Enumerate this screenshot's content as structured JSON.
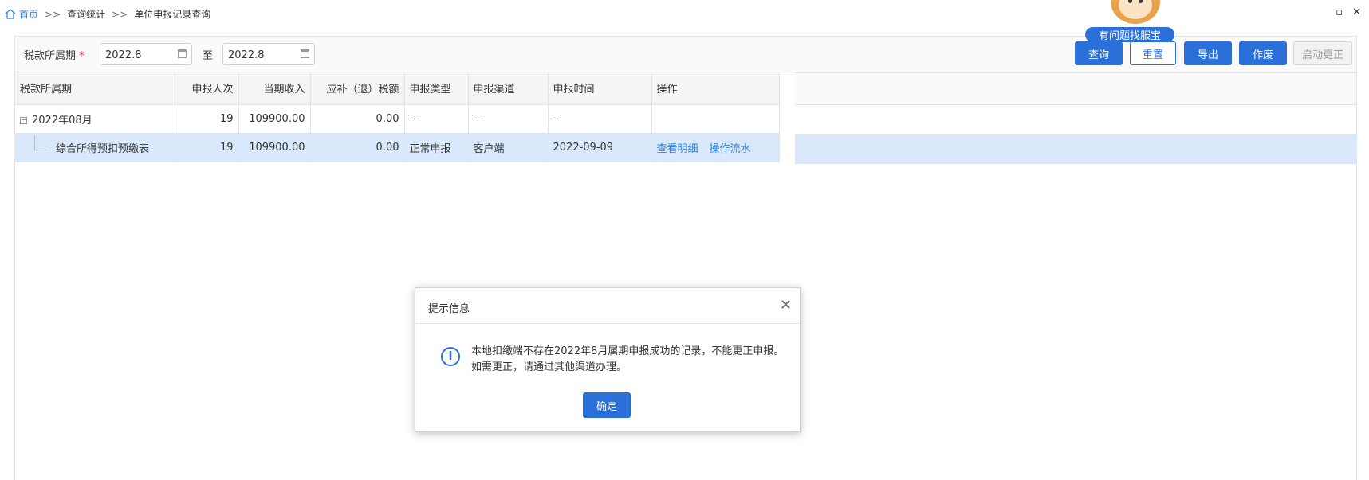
{
  "breadcrumb": {
    "home": "首页",
    "sep": ">>",
    "level1": "查询统计",
    "level2": "单位申报记录查询"
  },
  "window": {
    "restore_glyph": "▫",
    "close_glyph": "✕"
  },
  "filters": {
    "period_label": "税款所属期",
    "required_mark": "*",
    "to_label": "至",
    "start_value": "2022.8",
    "end_value": "2022.8"
  },
  "toolbar": {
    "query": "查询",
    "reset": "重置",
    "export": "导出",
    "void": "作废",
    "correct": "启动更正"
  },
  "mascot": {
    "label": "有问题找服宝"
  },
  "table": {
    "headers": [
      "税款所属期",
      "申报人次",
      "当期收入",
      "应补（退）税额",
      "申报类型",
      "申报渠道",
      "申报时间",
      "操作"
    ],
    "group_row": {
      "toggle": "−",
      "period": "2022年08月",
      "count": "19",
      "income": "109900.00",
      "tax": "0.00",
      "type": "--",
      "channel": "--",
      "time": "--"
    },
    "detail_row": {
      "period": "综合所得预扣预缴表",
      "count": "19",
      "income": "109900.00",
      "tax": "0.00",
      "type": "正常申报",
      "channel": "客户端",
      "time": "2022-09-09",
      "action_detail": "查看明细",
      "action_flow": "操作流水"
    }
  },
  "dialog": {
    "title": "提示信息",
    "close": "✕",
    "icon": "i",
    "message": "本地扣缴端不存在2022年8月属期申报成功的记录，不能更正申报。如需更正，请通过其他渠道办理。",
    "ok": "确定"
  },
  "colors": {
    "primary": "#2b6fd8",
    "selected_row": "#d9e8fb"
  }
}
